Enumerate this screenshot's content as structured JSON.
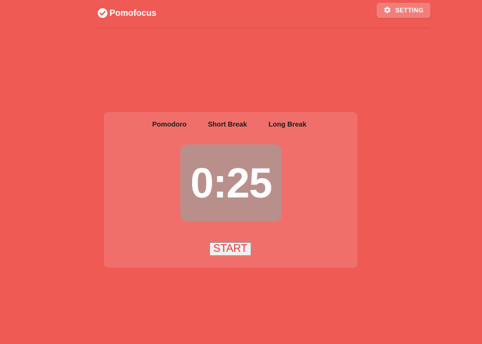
{
  "header": {
    "logo_text": "Pomofocus",
    "logo_icon": "check-circle-icon",
    "setting_label": "SETTING",
    "setting_icon": "gear-icon"
  },
  "modes": [
    {
      "label": "Pomodoro"
    },
    {
      "label": "Short Break"
    },
    {
      "label": "Long Break"
    }
  ],
  "timer": {
    "display": "0:25"
  },
  "controls": {
    "start_label": "START"
  },
  "colors": {
    "background": "#ef5a54",
    "timer_box": "#b98f8c",
    "start_text": "#e23b36"
  }
}
